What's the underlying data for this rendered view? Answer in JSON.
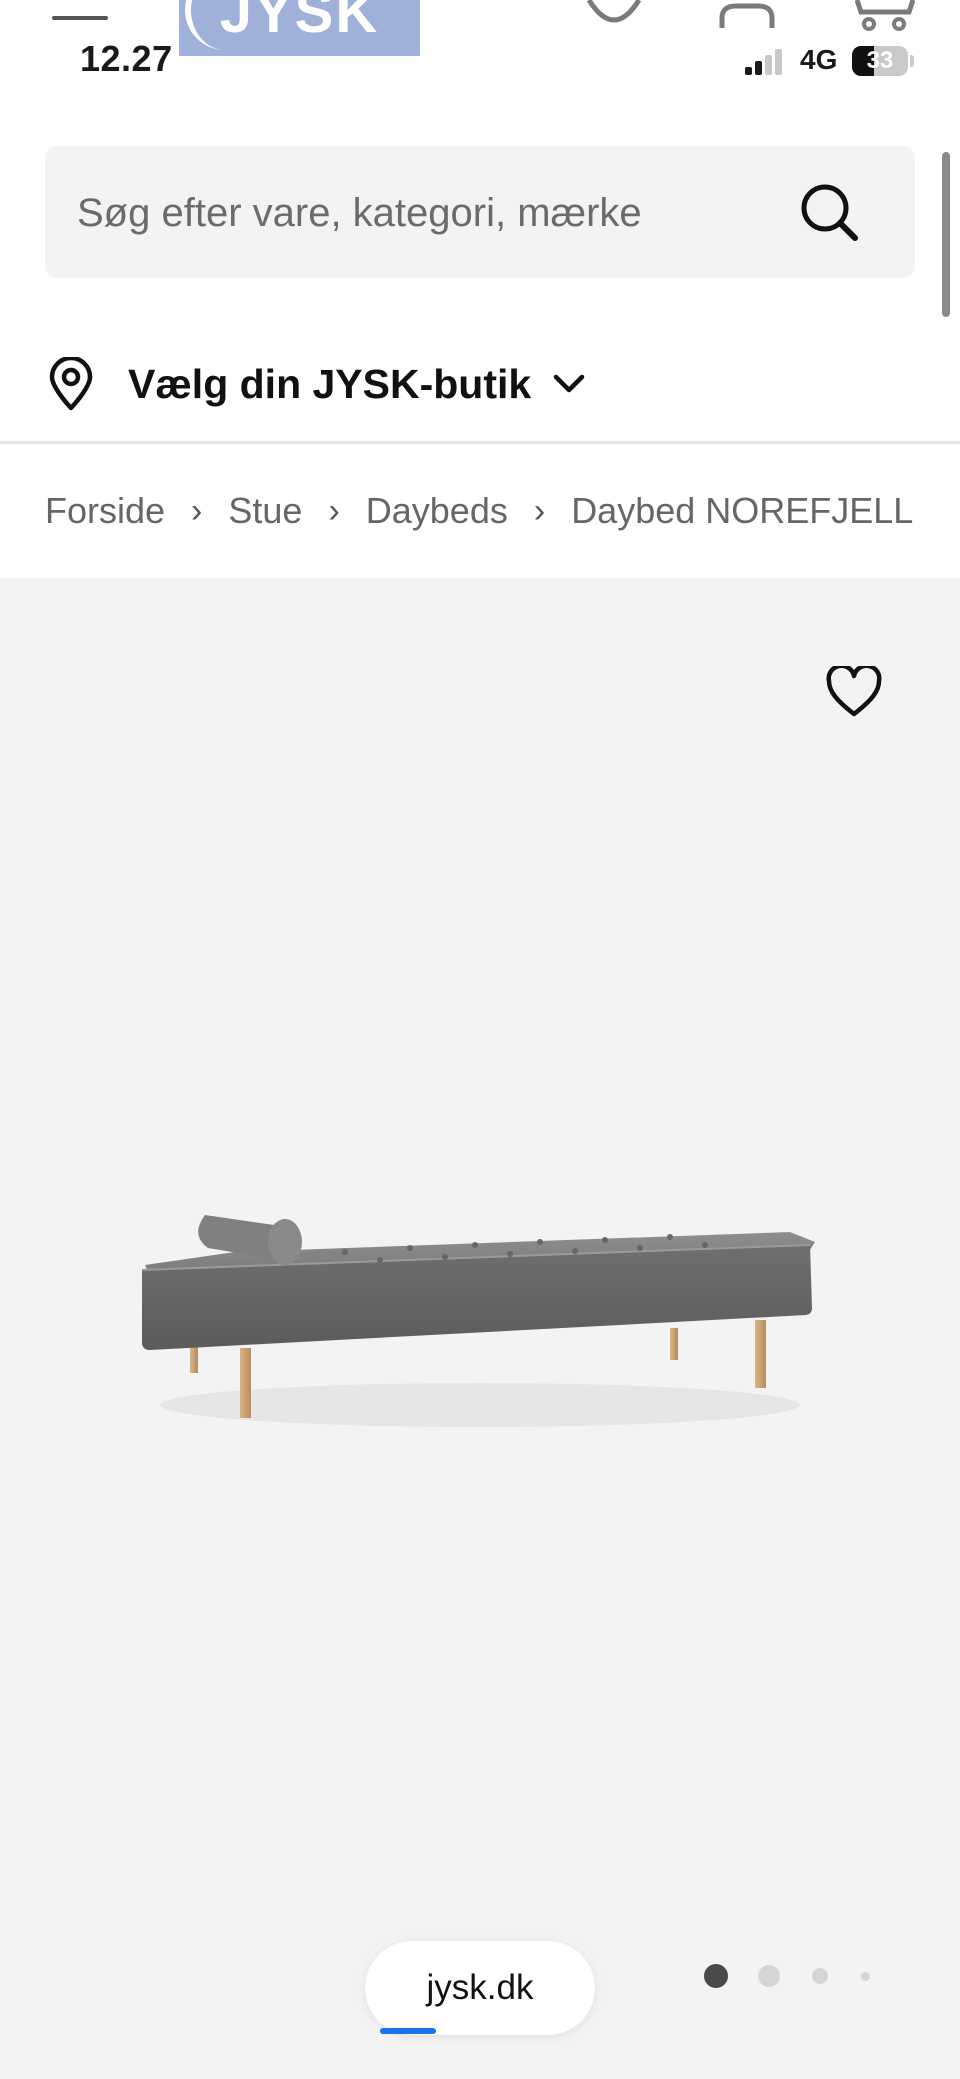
{
  "status_bar": {
    "time": "12.27",
    "network": "4G",
    "battery": "33"
  },
  "header": {
    "logo_text": "JYSK"
  },
  "search": {
    "placeholder": "Søg efter vare, kategori, mærke"
  },
  "store_selector": {
    "label": "Vælg din JYSK-butik"
  },
  "breadcrumb": [
    {
      "label": "Forside"
    },
    {
      "label": "Stue"
    },
    {
      "label": "Daybeds"
    },
    {
      "label": "Daybed NOREFJELL"
    }
  ],
  "gallery": {
    "current_image": 1,
    "image_count": 4
  },
  "browser": {
    "url": "jysk.dk"
  },
  "colors": {
    "accent": "#1a73e8",
    "gallery_bg": "#f3f3f3",
    "search_bg": "#f3f3f3",
    "logo_bg": "#9fb1d9"
  }
}
